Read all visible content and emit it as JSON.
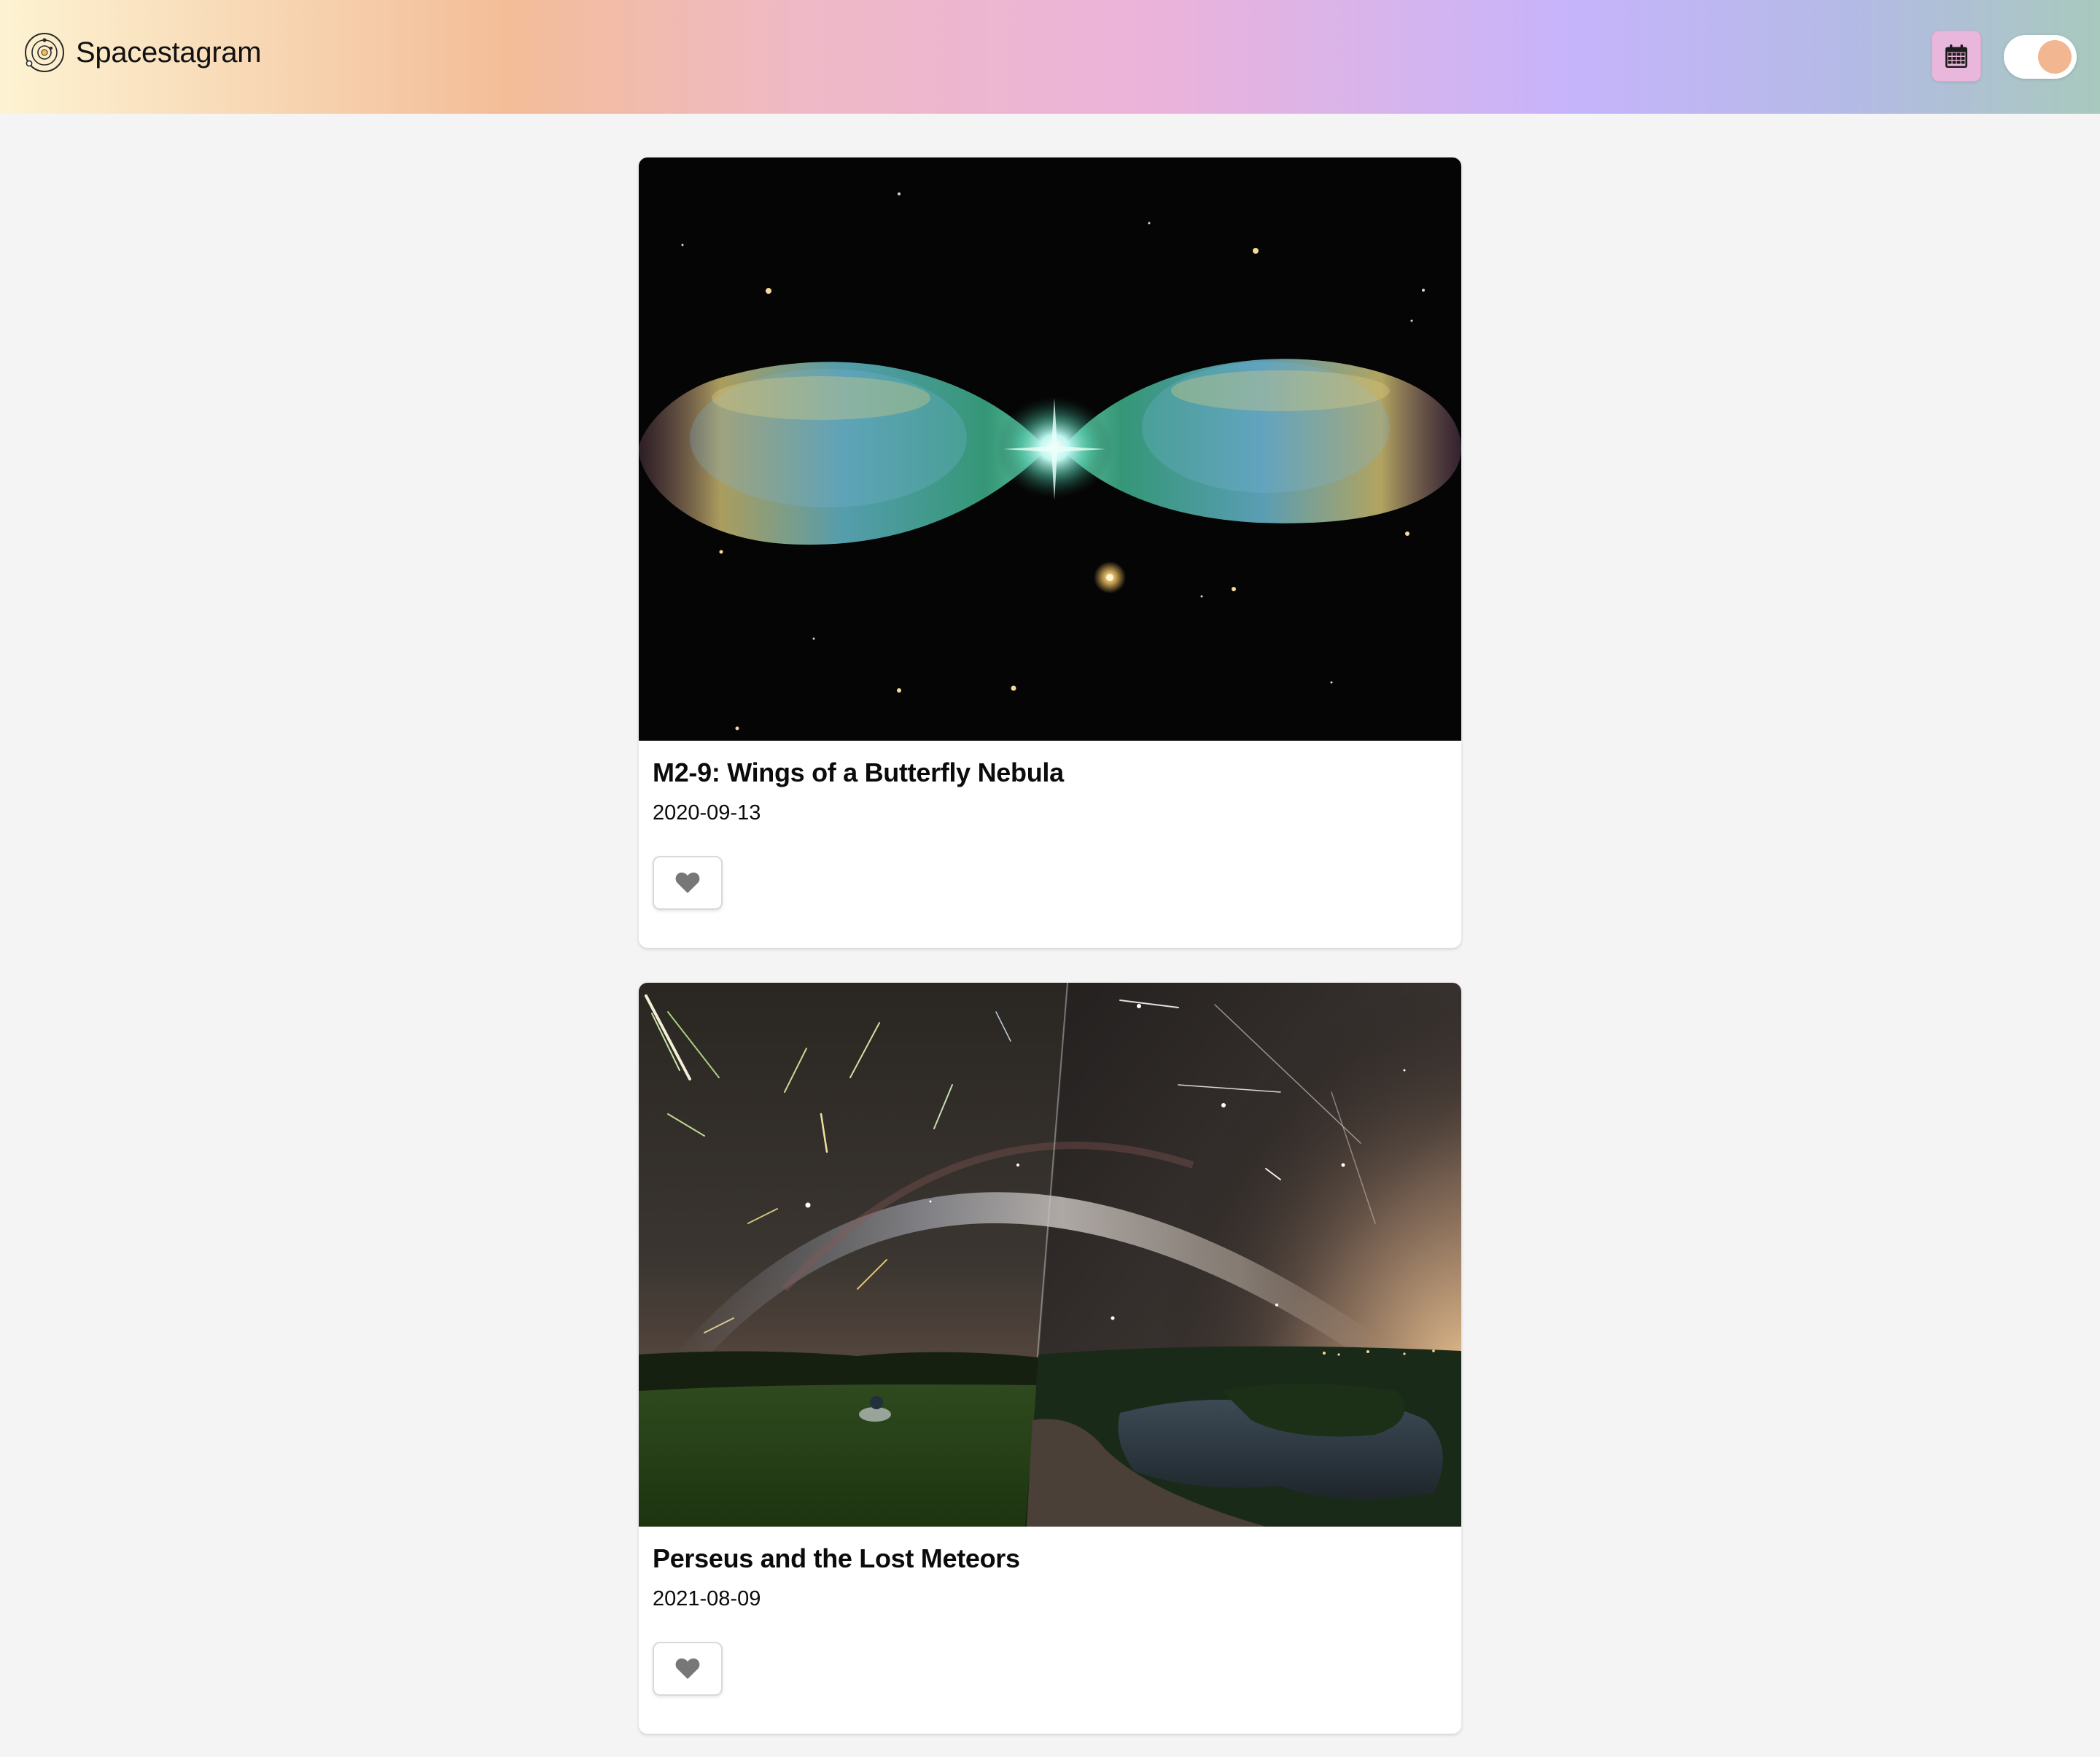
{
  "app": {
    "name": "Spacestagram",
    "logo_icon": "solar-system-logo-icon"
  },
  "header": {
    "calendar_icon": "calendar-icon",
    "calendar_button_color": "#eab7dc",
    "theme_toggle": {
      "state": "on",
      "knob_color": "#f2b790"
    }
  },
  "colors": {
    "page_background": "#f4f4f4",
    "card_background": "#ffffff",
    "like_icon": "#777777"
  },
  "posts": [
    {
      "image": "butterfly-nebula-photo",
      "title": "M2-9: Wings of a Butterfly Nebula",
      "date": "2020-09-13",
      "like_icon": "heart-icon",
      "liked": false
    },
    {
      "image": "perseid-meteors-milky-way-photo",
      "title": "Perseus and the Lost Meteors",
      "date": "2021-08-09",
      "like_icon": "heart-icon",
      "liked": false
    }
  ]
}
